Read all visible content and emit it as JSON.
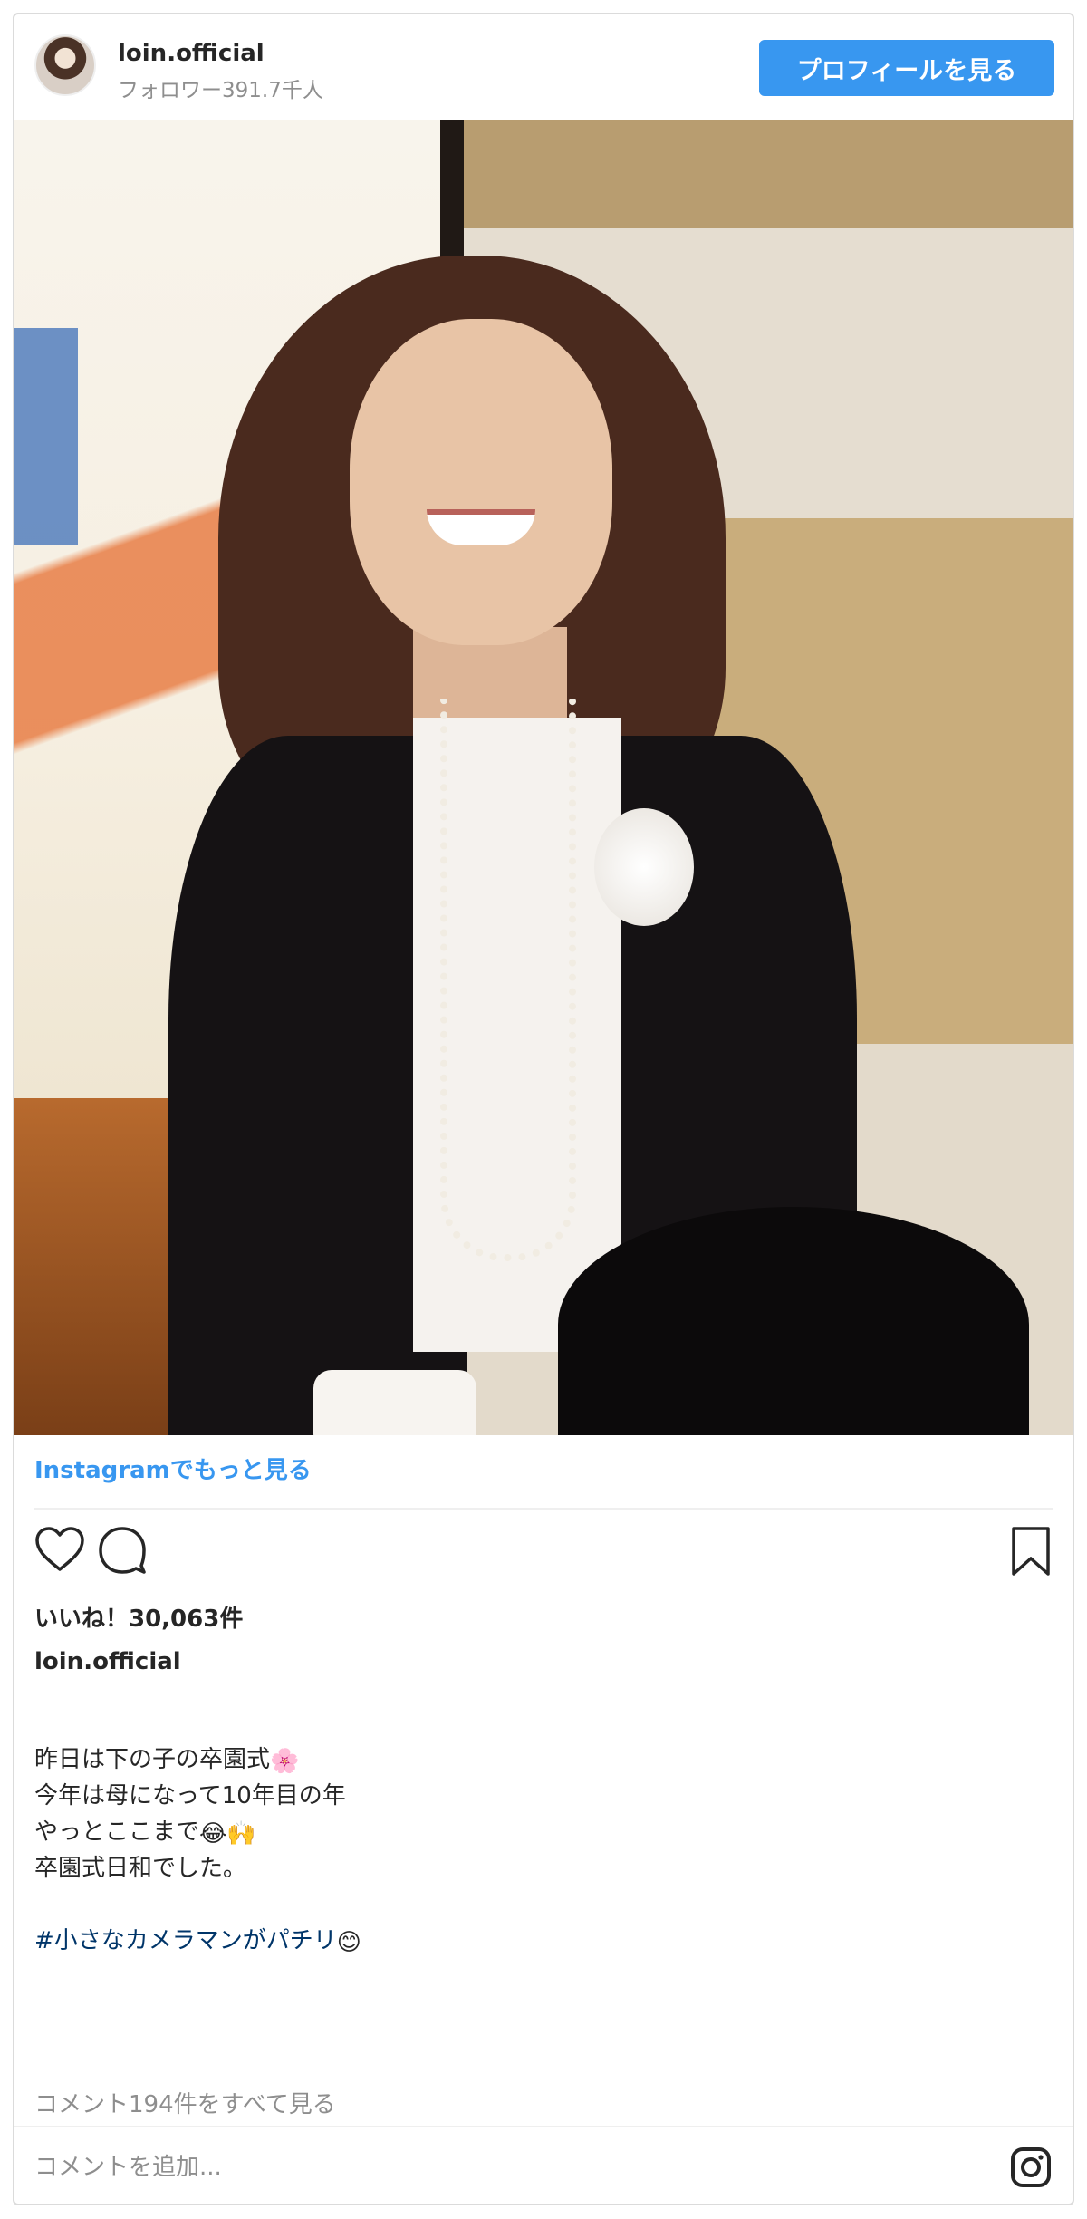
{
  "header": {
    "username": "loin.official",
    "followers": "フォロワー391.7千人",
    "profile_button": "プロフィールを見る"
  },
  "photo": {
    "subject": "photo-post"
  },
  "more_link": "Instagramでもっと見る",
  "actions": {
    "like_icon": "heart-icon",
    "comment_icon": "comment-icon",
    "save_icon": "bookmark-icon"
  },
  "likes": "いいね！30,063件",
  "owner": "loin.official",
  "caption": {
    "line1": "昨日は下の子の卒園式",
    "line1_emoji": "🌸",
    "line2": "今年は母になって10年目の年",
    "line3": "やっとここまで",
    "line3_emoji": "😂🙌",
    "line4": "卒園式日和でした。",
    "hashtag": "#小さなカメラマンがパチリ",
    "hashtag_emoji": "😊"
  },
  "view_comments": "コメント194件をすべて見る",
  "comment_placeholder": "コメントを追加...",
  "colors": {
    "accent": "#3897f0",
    "text": "#262626",
    "muted": "#8e8e8e",
    "border": "#dbdbdb"
  }
}
